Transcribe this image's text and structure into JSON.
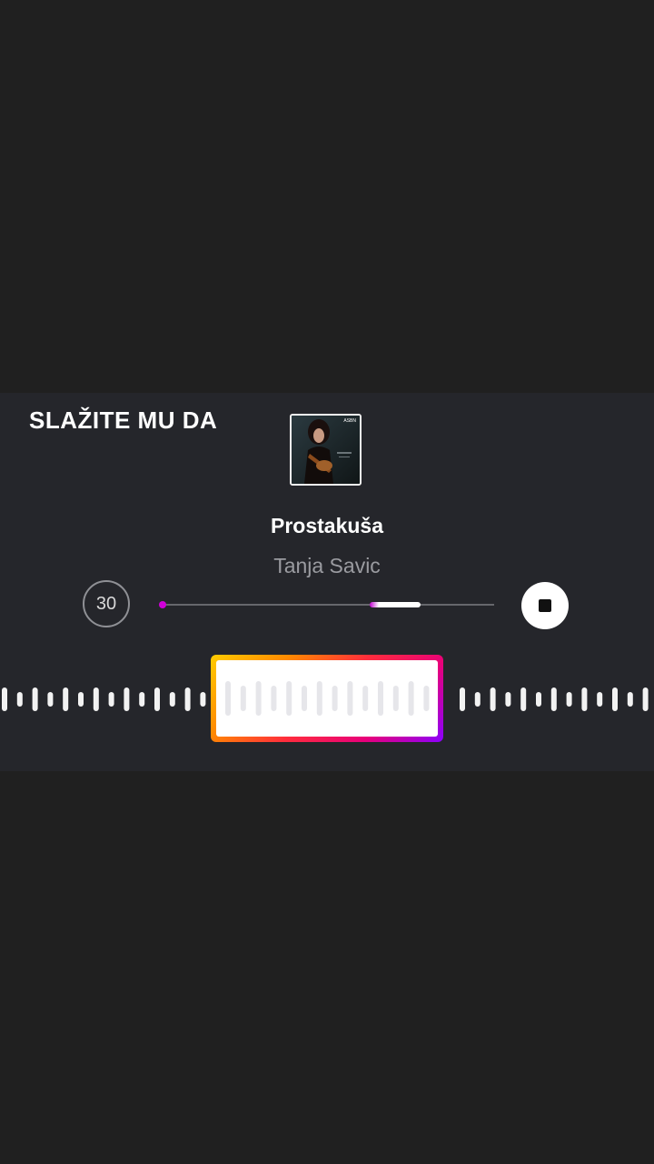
{
  "lyric_sticker": {
    "text": "SLAŽITE MU DA"
  },
  "song": {
    "title": "Prostakuša",
    "artist": "Tanja Savic",
    "cover_badge": "ASBN"
  },
  "controls": {
    "duration_label": "30",
    "stop_icon": "stop-icon",
    "selection_start_fraction": 0.62,
    "selection_end_fraction": 0.78
  },
  "colors": {
    "accent_gradient": [
      "#ffcc00",
      "#ff8a00",
      "#ff2d3c",
      "#e8007a",
      "#8a00ff"
    ],
    "progress_start": "#d000d8",
    "sheet_background": "#25262b"
  }
}
